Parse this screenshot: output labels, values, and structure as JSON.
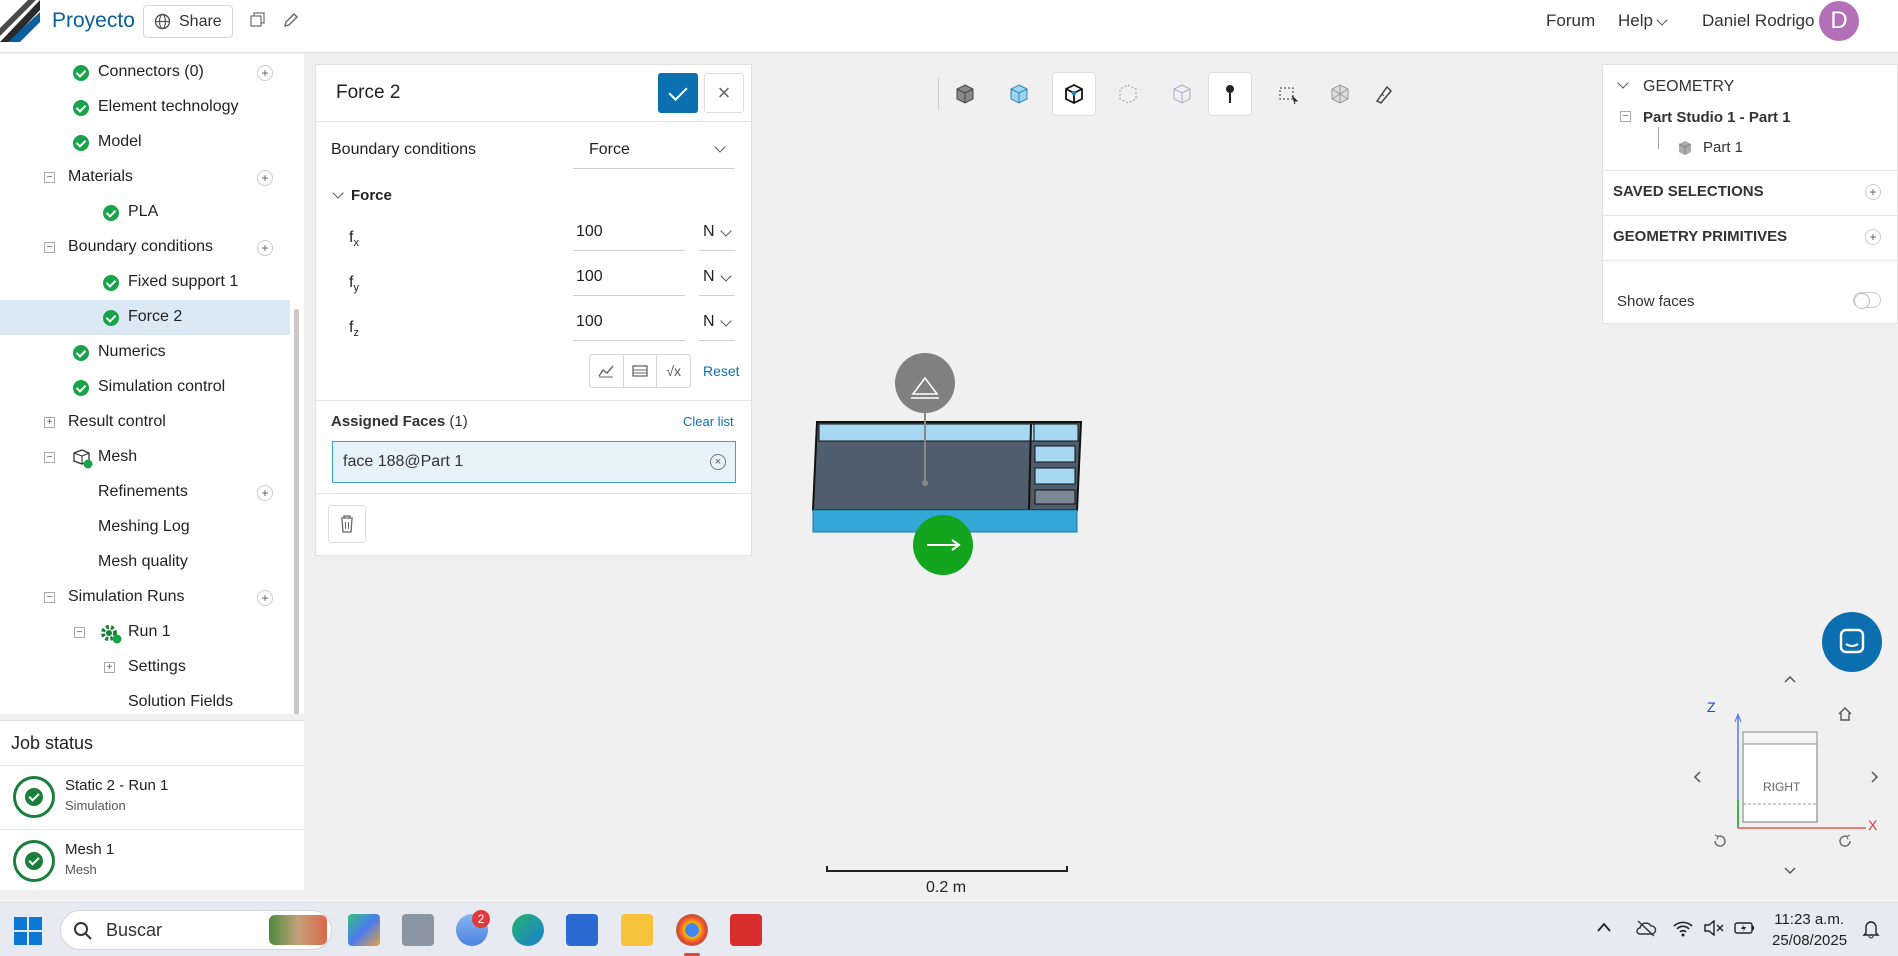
{
  "app": {
    "name": "Proyecto",
    "share_label": "Share"
  },
  "topnav": {
    "forum": "Forum",
    "help": "Help",
    "user": "Daniel Rodrigo",
    "avatar_letter": "D"
  },
  "tree": {
    "items": [
      {
        "label": "Connectors (0)"
      },
      {
        "label": "Element technology"
      },
      {
        "label": "Model"
      },
      {
        "label": "Materials"
      },
      {
        "label": "PLA"
      },
      {
        "label": "Boundary conditions"
      },
      {
        "label": "Fixed support 1"
      },
      {
        "label": "Force 2"
      },
      {
        "label": "Numerics"
      },
      {
        "label": "Simulation control"
      },
      {
        "label": "Result control"
      },
      {
        "label": "Mesh"
      },
      {
        "label": "Refinements"
      },
      {
        "label": "Meshing Log"
      },
      {
        "label": "Mesh quality"
      },
      {
        "label": "Simulation Runs"
      },
      {
        "label": "Run 1"
      },
      {
        "label": "Settings"
      },
      {
        "label": "Solution Fields"
      }
    ]
  },
  "job_status": {
    "title": "Job status",
    "jobs": [
      {
        "name": "Static 2 - Run 1",
        "type": "Simulation"
      },
      {
        "name": "Mesh 1",
        "type": "Mesh"
      }
    ]
  },
  "panel": {
    "title": "Force 2",
    "bc_label": "Boundary conditions",
    "bc_value": "Force",
    "section": "Force",
    "components": [
      {
        "label": "f",
        "sub": "x",
        "value": "100",
        "unit": "N"
      },
      {
        "label": "f",
        "sub": "y",
        "value": "100",
        "unit": "N"
      },
      {
        "label": "f",
        "sub": "z",
        "value": "100",
        "unit": "N"
      }
    ],
    "reset_label": "Reset",
    "sqrt_label": "√x",
    "assigned_label": "Assigned Faces",
    "assigned_count": "(1)",
    "clear_label": "Clear list",
    "face": "face 188@Part 1"
  },
  "right_panel": {
    "geometry": "GEOMETRY",
    "studio": "Part Studio 1 - Part 1",
    "part": "Part 1",
    "saved": "SAVED SELECTIONS",
    "primitives": "GEOMETRY PRIMITIVES",
    "show_faces": "Show faces",
    "show_faces_on": false
  },
  "viewcube": {
    "z": "Z",
    "x": "X",
    "face": "RIGHT"
  },
  "scale": {
    "label": "0.2 m"
  },
  "taskbar": {
    "search": "Buscar",
    "badge": "2",
    "time": "11:23 a.m.",
    "date": "25/08/2025"
  },
  "colors": {
    "accent": "#0c6fb0",
    "success": "#16a34a",
    "force_arrow": "#14a51e",
    "selection": "#3ea2d0"
  }
}
